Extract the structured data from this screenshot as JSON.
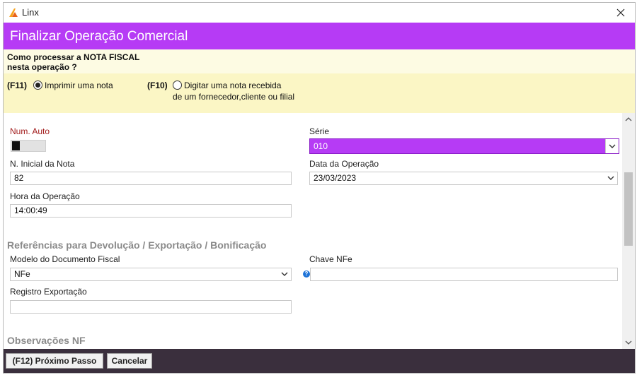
{
  "window": {
    "app_title": "Linx"
  },
  "header": {
    "title": "Finalizar Operação Comercial"
  },
  "question": {
    "line1": "Como processar a NOTA FISCAL",
    "line2": "nesta operação ?",
    "option1": {
      "key": "(F11)",
      "label": "Imprimir uma nota",
      "selected": true
    },
    "option2": {
      "key": "(F10)",
      "label_line1": "Digitar uma nota recebida",
      "label_line2": "de um fornecedor,cliente ou filial",
      "selected": false
    }
  },
  "form": {
    "num_auto_label": "Num. Auto",
    "serie_label": "Série",
    "serie_value": "010",
    "n_inicial_label": "N. Inicial da Nota",
    "n_inicial_value": "82",
    "data_operacao_label": "Data da Operação",
    "data_operacao_value": "23/03/2023",
    "hora_operacao_label": "Hora da Operação",
    "hora_operacao_value": "14:00:49"
  },
  "references": {
    "section_title": "Referências para Devolução / Exportação / Bonificação",
    "modelo_label": "Modelo do Documento Fiscal",
    "modelo_value": "NFe",
    "chave_label": "Chave NFe",
    "chave_value": "",
    "registro_label": "Registro Exportação",
    "registro_value": ""
  },
  "observacoes": {
    "section_title": "Observações NF"
  },
  "footer": {
    "next_label": "(F12) Próximo Passo",
    "cancel_label": "Cancelar"
  },
  "colors": {
    "accent": "#b63bf5",
    "panel_yellow": "#fbf6c5",
    "footer": "#3a2f3d"
  }
}
